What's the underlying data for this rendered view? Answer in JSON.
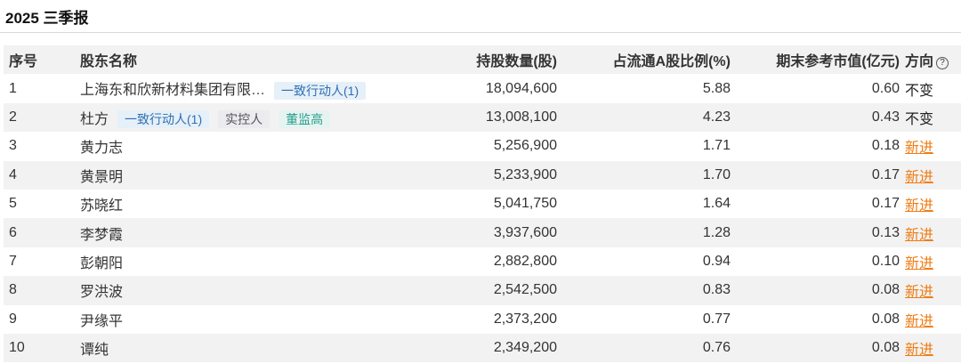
{
  "report_title": "2025 三季报",
  "headers": {
    "no": "序号",
    "name": "股东名称",
    "shares": "持股数量(股)",
    "pct": "占流通A股比例(%)",
    "value": "期末参考市值(亿元)",
    "direction": "方向",
    "help_icon": "?"
  },
  "rows": [
    {
      "no": "1",
      "name": "上海东和欣新材料集团有限…",
      "tags": [
        {
          "text": "一致行动人(1)",
          "kind": "blue"
        }
      ],
      "shares": "18,094,600",
      "pct": "5.88",
      "value": "0.60",
      "direction": "不变"
    },
    {
      "no": "2",
      "name": "杜方",
      "tags": [
        {
          "text": "一致行动人(1)",
          "kind": "blue"
        },
        {
          "text": "实控人",
          "kind": "grey"
        },
        {
          "text": "董监高",
          "kind": "teal"
        }
      ],
      "shares": "13,008,100",
      "pct": "4.23",
      "value": "0.43",
      "direction": "不变"
    },
    {
      "no": "3",
      "name": "黄力志",
      "tags": [],
      "shares": "5,256,900",
      "pct": "1.71",
      "value": "0.18",
      "direction": "新进"
    },
    {
      "no": "4",
      "name": "黄景明",
      "tags": [],
      "shares": "5,233,900",
      "pct": "1.70",
      "value": "0.17",
      "direction": "新进"
    },
    {
      "no": "5",
      "name": "苏晓红",
      "tags": [],
      "shares": "5,041,750",
      "pct": "1.64",
      "value": "0.17",
      "direction": "新进"
    },
    {
      "no": "6",
      "name": "李梦霞",
      "tags": [],
      "shares": "3,937,600",
      "pct": "1.28",
      "value": "0.13",
      "direction": "新进"
    },
    {
      "no": "7",
      "name": "彭朝阳",
      "tags": [],
      "shares": "2,882,800",
      "pct": "0.94",
      "value": "0.10",
      "direction": "新进"
    },
    {
      "no": "8",
      "name": "罗洪波",
      "tags": [],
      "shares": "2,542,500",
      "pct": "0.83",
      "value": "0.08",
      "direction": "新进"
    },
    {
      "no": "9",
      "name": "尹缘平",
      "tags": [],
      "shares": "2,373,200",
      "pct": "0.77",
      "value": "0.08",
      "direction": "新进"
    },
    {
      "no": "10",
      "name": "谭纯",
      "tags": [],
      "shares": "2,349,200",
      "pct": "0.76",
      "value": "0.08",
      "direction": "新进"
    }
  ]
}
